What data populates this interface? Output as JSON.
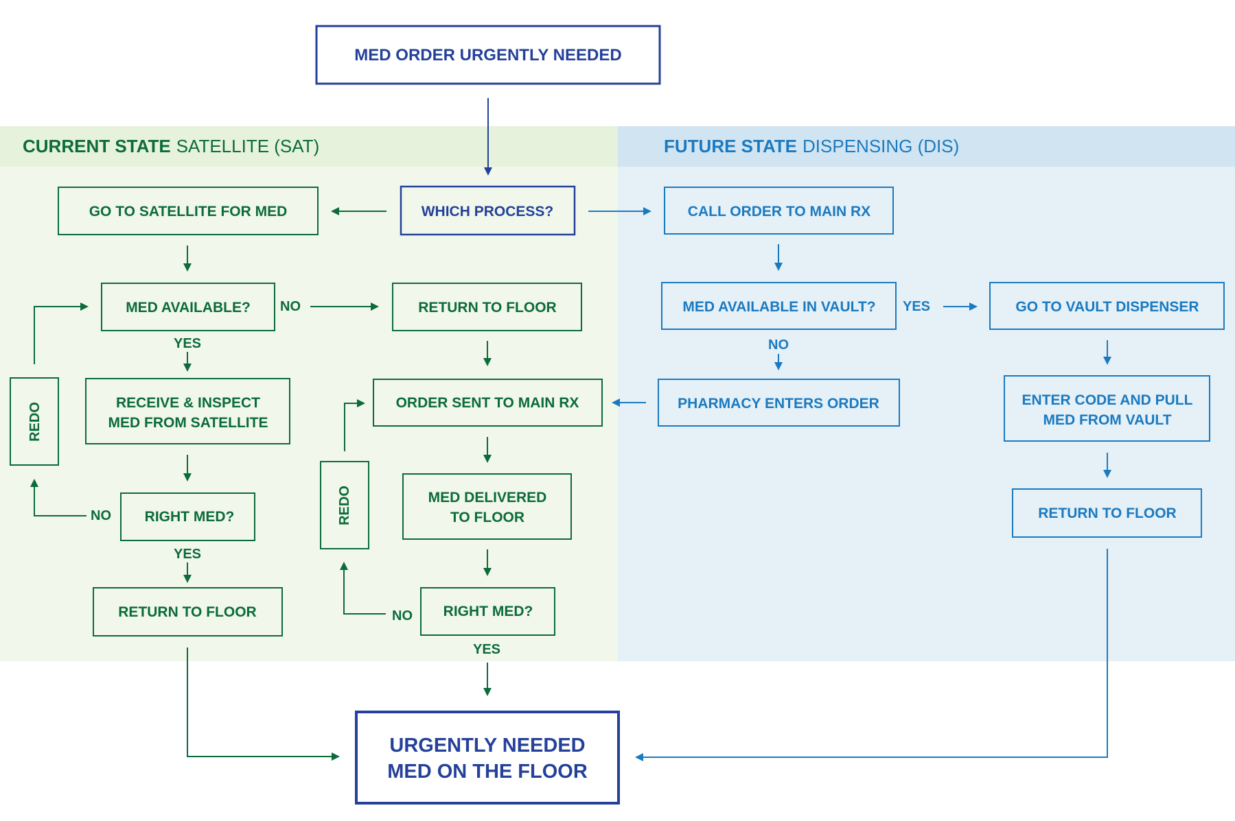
{
  "colors": {
    "navy": "#24409a",
    "green": "#0b6b3a",
    "blue": "#1a7ac0",
    "green_header_bg": "#e6f2db",
    "green_body_bg": "#f1f7ea",
    "blue_header_bg": "#d1e4f1",
    "blue_body_bg": "#e5f0f7"
  },
  "start": {
    "label": "MED ORDER URGENTLY NEEDED"
  },
  "end": {
    "line1": "URGENTLY NEEDED",
    "line2": "MED ON THE FLOOR"
  },
  "decision": {
    "label": "WHICH PROCESS?"
  },
  "current_state": {
    "title_bold": "CURRENT STATE",
    "title_light": "SATELLITE (SAT)",
    "steps": {
      "go_to_satellite": "GO TO SATELLITE FOR MED",
      "med_available": "MED AVAILABLE?",
      "receive_line1": "RECEIVE & INSPECT",
      "receive_line2": "MED FROM SATELLITE",
      "right_med_1": "RIGHT MED?",
      "return_floor_1": "RETURN TO FLOOR",
      "return_floor_2": "RETURN TO FLOOR",
      "order_sent": "ORDER SENT TO MAIN RX",
      "delivered_line1": "MED DELIVERED",
      "delivered_line2": "TO FLOOR",
      "right_med_2": "RIGHT MED?",
      "redo_1": "REDO",
      "redo_2": "REDO"
    },
    "labels": {
      "no_available": "NO",
      "yes_available": "YES",
      "no_right_1": "NO",
      "yes_right_1": "YES",
      "no_right_2": "NO",
      "yes_right_2": "YES"
    }
  },
  "future_state": {
    "title_bold": "FUTURE STATE",
    "title_light": "DISPENSING (DIS)",
    "steps": {
      "call_order": "CALL ORDER TO MAIN RX",
      "available_vault": "MED AVAILABLE IN VAULT?",
      "go_vault": "GO TO VAULT DISPENSER",
      "pharmacy_enters": "PHARMACY ENTERS ORDER",
      "enter_code_line1": "ENTER CODE AND PULL",
      "enter_code_line2": "MED FROM VAULT",
      "return_floor": "RETURN TO FLOOR"
    },
    "labels": {
      "yes_vault": "YES",
      "no_vault": "NO"
    }
  }
}
